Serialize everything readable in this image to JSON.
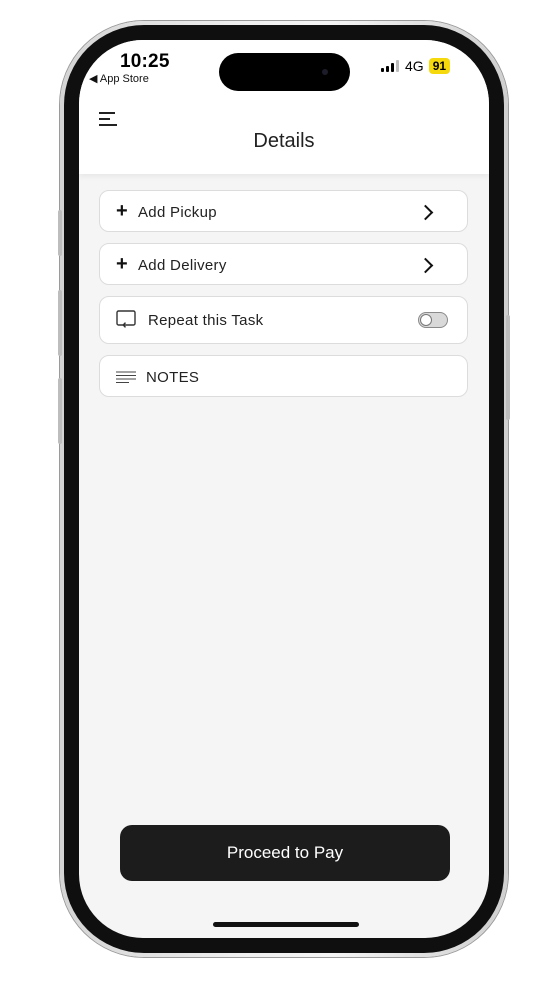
{
  "status_bar": {
    "time": "10:25",
    "back_app": "◀ App Store",
    "network": "4G",
    "battery": "91",
    "battery_color": "#f5d90c"
  },
  "header": {
    "menu_icon": "hamburger-menu-icon",
    "title": "Details"
  },
  "rows": {
    "add_pickup": {
      "label": "Add Pickup",
      "icon": "plus-icon",
      "trailing": "chevron-right-icon"
    },
    "add_delivery": {
      "label": "Add Delivery",
      "icon": "plus-icon",
      "trailing": "chevron-right-icon"
    },
    "repeat_task": {
      "label": "Repeat this Task",
      "icon": "repeat-icon",
      "toggle_on": false
    },
    "notes": {
      "label": "NOTES",
      "icon": "notes-lines-icon"
    }
  },
  "footer": {
    "pay_label": "Proceed to Pay",
    "pay_color": "#1c1c1c"
  }
}
